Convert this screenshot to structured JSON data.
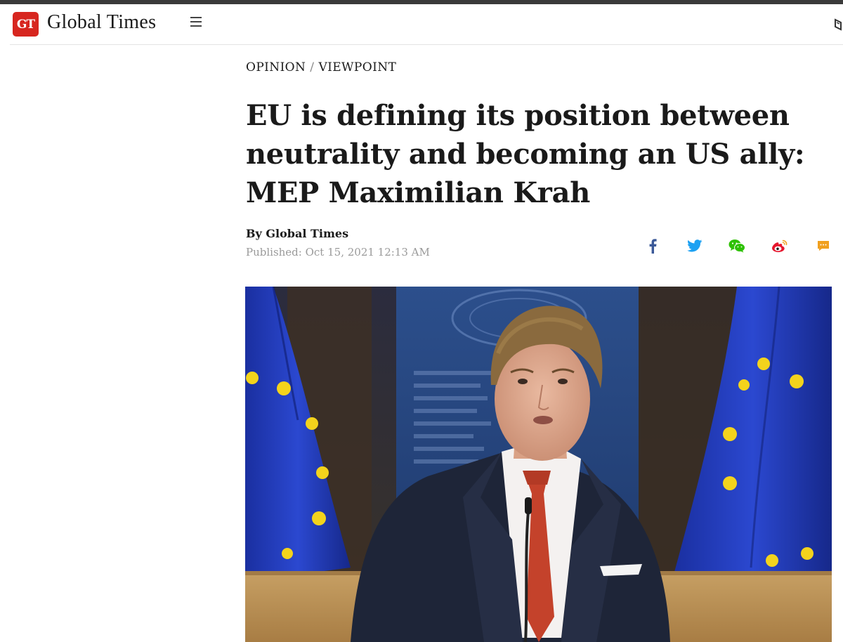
{
  "header": {
    "logo_badge": "GT",
    "logo_text": "Global Times",
    "menu_icon": "hamburger-menu-icon"
  },
  "breadcrumb": {
    "section": "OPINION",
    "separator": "/",
    "subsection": "VIEWPOINT"
  },
  "article": {
    "headline": "EU is defining its position between neutrality and becoming an US ally: MEP Maximilian Krah",
    "byline": "By Global Times",
    "published": "Published: Oct 15, 2021 12:13 AM"
  },
  "share": {
    "icons": [
      "facebook-icon",
      "twitter-icon",
      "wechat-icon",
      "weibo-icon",
      "comment-icon"
    ]
  },
  "colors": {
    "brand_red": "#d7261f",
    "facebook": "#3b5998",
    "twitter": "#1da1f2",
    "wechat": "#2dc100",
    "weibo": "#e6162d",
    "comment": "#f0a020"
  },
  "photo": {
    "subject": "Man in dark suit and red tie speaking at microphone in front of EU flags"
  }
}
